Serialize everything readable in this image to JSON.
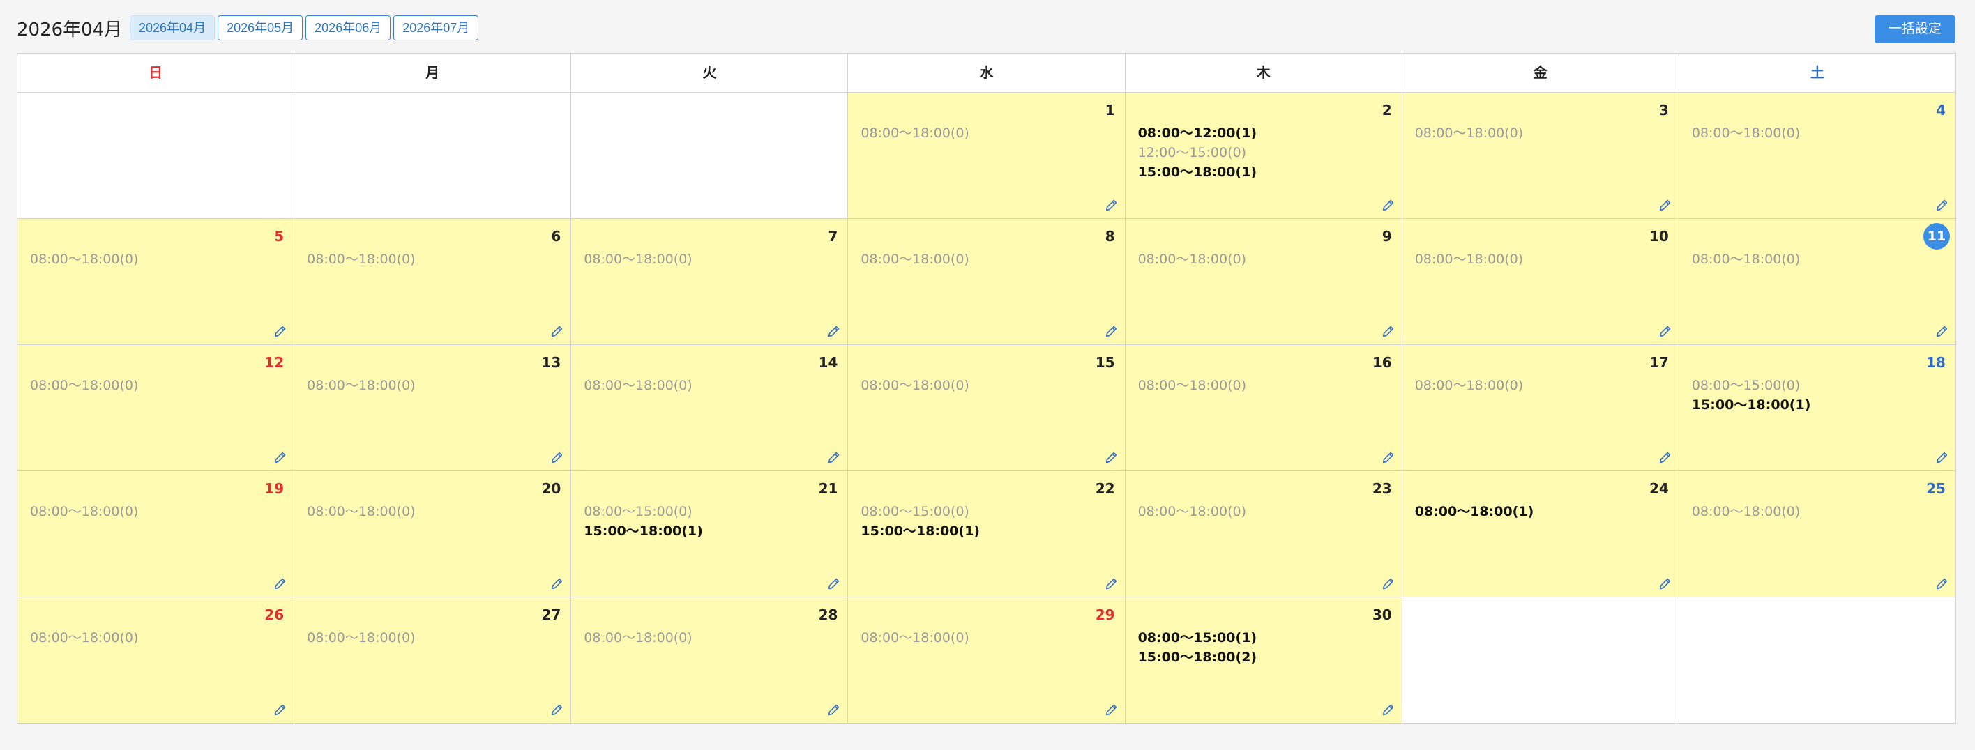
{
  "header": {
    "title": "2026年04月",
    "month_tabs": [
      {
        "label": "2026年04月",
        "active": true
      },
      {
        "label": "2026年05月",
        "active": false
      },
      {
        "label": "2026年06月",
        "active": false
      },
      {
        "label": "2026年07月",
        "active": false
      }
    ],
    "bulk_button_label": "一括設定"
  },
  "calendar": {
    "weekdays": [
      "日",
      "月",
      "火",
      "水",
      "木",
      "金",
      "土"
    ],
    "weeks": [
      [
        null,
        null,
        null,
        {
          "day": "1",
          "slots": [
            {
              "text": "08:00〜18:00(0)",
              "booked": false
            }
          ]
        },
        {
          "day": "2",
          "slots": [
            {
              "text": "08:00〜12:00(1)",
              "booked": true
            },
            {
              "text": "12:00〜15:00(0)",
              "booked": false
            },
            {
              "text": "15:00〜18:00(1)",
              "booked": true
            }
          ]
        },
        {
          "day": "3",
          "slots": [
            {
              "text": "08:00〜18:00(0)",
              "booked": false
            }
          ]
        },
        {
          "day": "4",
          "slots": [
            {
              "text": "08:00〜18:00(0)",
              "booked": false
            }
          ]
        }
      ],
      [
        {
          "day": "5",
          "slots": [
            {
              "text": "08:00〜18:00(0)",
              "booked": false
            }
          ]
        },
        {
          "day": "6",
          "slots": [
            {
              "text": "08:00〜18:00(0)",
              "booked": false
            }
          ]
        },
        {
          "day": "7",
          "slots": [
            {
              "text": "08:00〜18:00(0)",
              "booked": false
            }
          ]
        },
        {
          "day": "8",
          "slots": [
            {
              "text": "08:00〜18:00(0)",
              "booked": false
            }
          ]
        },
        {
          "day": "9",
          "slots": [
            {
              "text": "08:00〜18:00(0)",
              "booked": false
            }
          ]
        },
        {
          "day": "10",
          "slots": [
            {
              "text": "08:00〜18:00(0)",
              "booked": false
            }
          ]
        },
        {
          "day": "11",
          "today": true,
          "slots": [
            {
              "text": "08:00〜18:00(0)",
              "booked": false
            }
          ]
        }
      ],
      [
        {
          "day": "12",
          "slots": [
            {
              "text": "08:00〜18:00(0)",
              "booked": false
            }
          ]
        },
        {
          "day": "13",
          "slots": [
            {
              "text": "08:00〜18:00(0)",
              "booked": false
            }
          ]
        },
        {
          "day": "14",
          "slots": [
            {
              "text": "08:00〜18:00(0)",
              "booked": false
            }
          ]
        },
        {
          "day": "15",
          "slots": [
            {
              "text": "08:00〜18:00(0)",
              "booked": false
            }
          ]
        },
        {
          "day": "16",
          "slots": [
            {
              "text": "08:00〜18:00(0)",
              "booked": false
            }
          ]
        },
        {
          "day": "17",
          "slots": [
            {
              "text": "08:00〜18:00(0)",
              "booked": false
            }
          ]
        },
        {
          "day": "18",
          "slots": [
            {
              "text": "08:00〜15:00(0)",
              "booked": false
            },
            {
              "text": "15:00〜18:00(1)",
              "booked": true
            }
          ]
        }
      ],
      [
        {
          "day": "19",
          "slots": [
            {
              "text": "08:00〜18:00(0)",
              "booked": false
            }
          ]
        },
        {
          "day": "20",
          "slots": [
            {
              "text": "08:00〜18:00(0)",
              "booked": false
            }
          ]
        },
        {
          "day": "21",
          "slots": [
            {
              "text": "08:00〜15:00(0)",
              "booked": false
            },
            {
              "text": "15:00〜18:00(1)",
              "booked": true
            }
          ]
        },
        {
          "day": "22",
          "slots": [
            {
              "text": "08:00〜15:00(0)",
              "booked": false
            },
            {
              "text": "15:00〜18:00(1)",
              "booked": true
            }
          ]
        },
        {
          "day": "23",
          "slots": [
            {
              "text": "08:00〜18:00(0)",
              "booked": false
            }
          ]
        },
        {
          "day": "24",
          "slots": [
            {
              "text": "08:00〜18:00(1)",
              "booked": true
            }
          ]
        },
        {
          "day": "25",
          "slots": [
            {
              "text": "08:00〜18:00(0)",
              "booked": false
            }
          ]
        }
      ],
      [
        {
          "day": "26",
          "slots": [
            {
              "text": "08:00〜18:00(0)",
              "booked": false
            }
          ]
        },
        {
          "day": "27",
          "slots": [
            {
              "text": "08:00〜18:00(0)",
              "booked": false
            }
          ]
        },
        {
          "day": "28",
          "slots": [
            {
              "text": "08:00〜18:00(0)",
              "booked": false
            }
          ]
        },
        {
          "day": "29",
          "holiday": true,
          "slots": [
            {
              "text": "08:00〜18:00(0)",
              "booked": false
            }
          ]
        },
        {
          "day": "30",
          "slots": [
            {
              "text": "08:00〜15:00(1)",
              "booked": true
            },
            {
              "text": "15:00〜18:00(2)",
              "booked": true
            }
          ]
        },
        null,
        null
      ]
    ]
  },
  "icons": {
    "edit": "pencil-icon"
  },
  "colors": {
    "available_bg": "#fffbb3",
    "accent": "#3a8ee6",
    "sunday": "#e03131",
    "saturday": "#2e6bc7"
  }
}
